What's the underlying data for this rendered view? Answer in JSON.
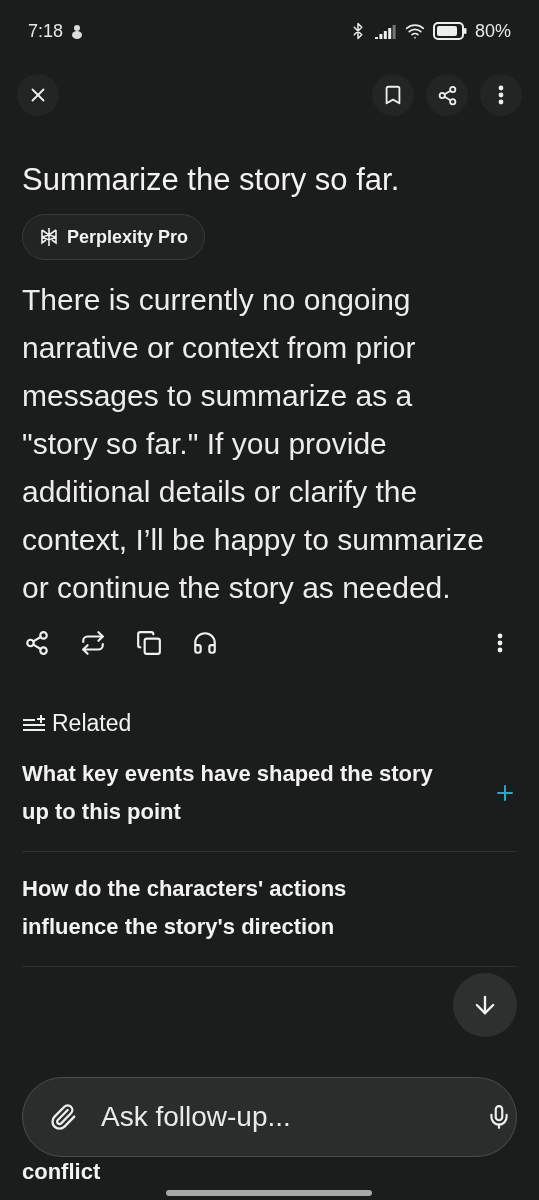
{
  "status_bar": {
    "time": "7:18",
    "battery": "80%"
  },
  "question": "Summarize the story so far.",
  "model_badge": "Perplexity Pro",
  "answer": "There is currently no ongoing narrative or context from prior messages to summarize as a \"story so far.\" If you provide additional details or clarify the context, I’ll be happy to summarize or continue the story as needed.",
  "related": {
    "title": "Related",
    "items": [
      {
        "text": "What key events have shaped the story up to this point"
      },
      {
        "text": "How do the characters' actions influence the story's direction"
      },
      {
        "text": "conflict"
      }
    ]
  },
  "follow_up": {
    "placeholder": "Ask follow-up..."
  }
}
